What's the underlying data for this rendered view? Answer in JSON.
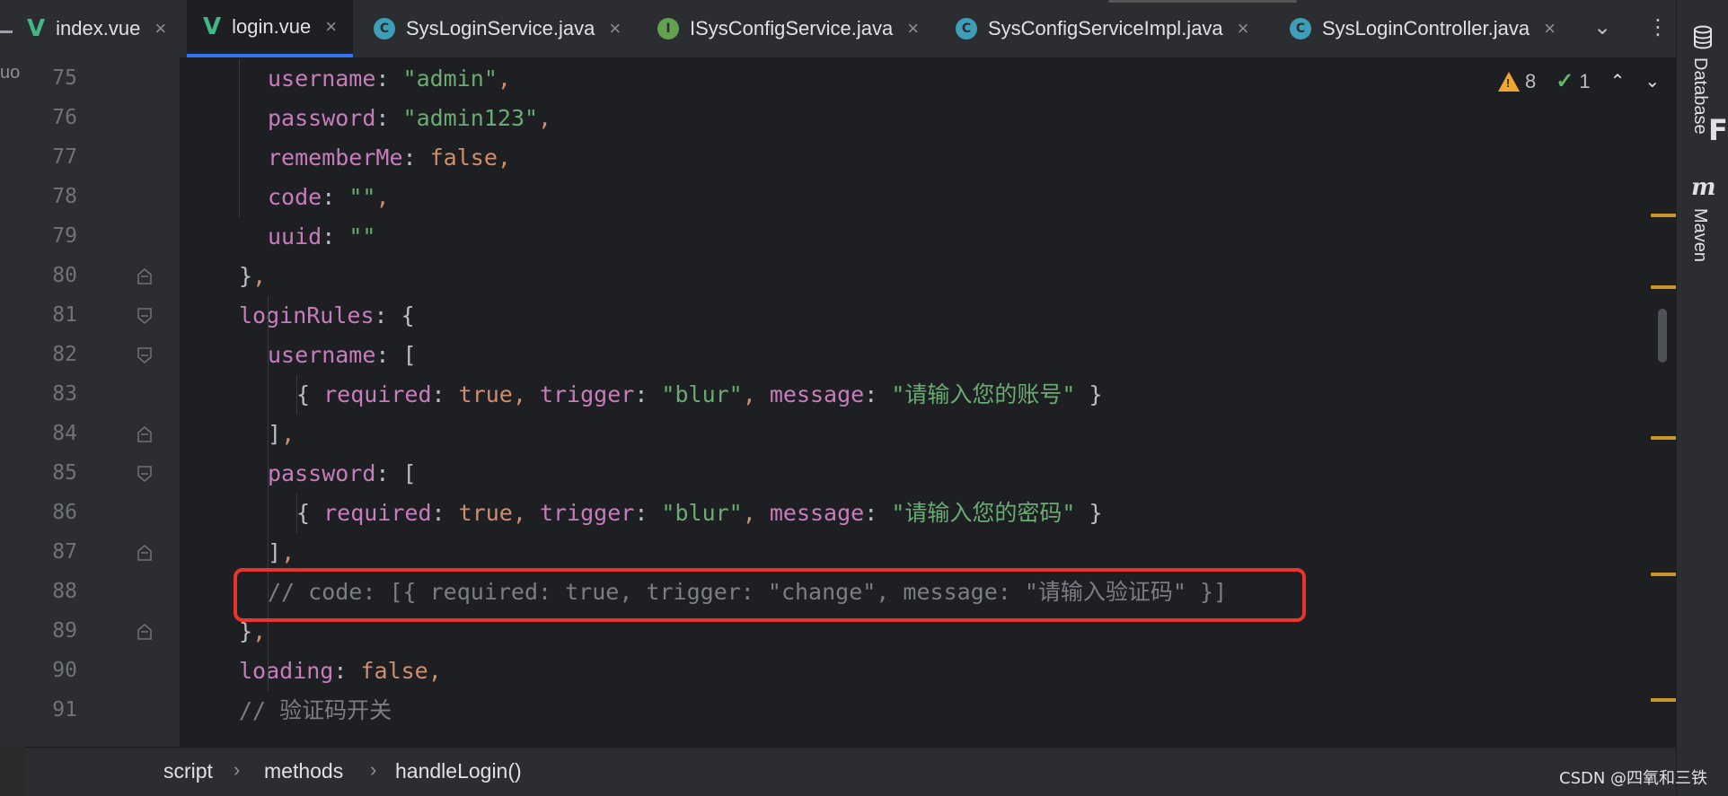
{
  "tabs": [
    {
      "icon": "vue-icon",
      "label": "index.vue",
      "active": false
    },
    {
      "icon": "vue-icon",
      "label": "login.vue",
      "active": true
    },
    {
      "icon": "class-icon",
      "label": "SysLoginService.java",
      "active": false
    },
    {
      "icon": "interface-icon",
      "label": "ISysConfigService.java",
      "active": false
    },
    {
      "icon": "class-icon",
      "label": "SysConfigServiceImpl.java",
      "active": false
    },
    {
      "icon": "class-icon",
      "label": "SysLoginController.java",
      "active": false
    }
  ],
  "tab_glyphs": {
    "close": "×",
    "vue": "V",
    "class": "C",
    "interface": "I",
    "dropdown": "⌄",
    "more": "⋮"
  },
  "left_edge_text": "uo",
  "right_tools": {
    "database": "Database",
    "maven": "Maven",
    "maven_icon": "m",
    "edge_glyph": "F"
  },
  "inspections": {
    "warnings": "8",
    "weak_warnings": "1",
    "warn_mark": "!",
    "check_mark": "✓",
    "up": "⌃",
    "down": "⌄"
  },
  "lines": [
    {
      "n": "75",
      "segs": [
        [
          "k",
          "username"
        ],
        [
          "p",
          ": "
        ],
        [
          "s",
          "\"admin\""
        ],
        [
          "b",
          ","
        ]
      ]
    },
    {
      "n": "76",
      "segs": [
        [
          "k",
          "password"
        ],
        [
          "p",
          ": "
        ],
        [
          "s",
          "\"admin123\""
        ],
        [
          "b",
          ","
        ]
      ]
    },
    {
      "n": "77",
      "segs": [
        [
          "k",
          "rememberMe"
        ],
        [
          "p",
          ": "
        ],
        [
          "b",
          "false,"
        ]
      ]
    },
    {
      "n": "78",
      "segs": [
        [
          "k",
          "code"
        ],
        [
          "p",
          ": "
        ],
        [
          "s",
          "\"\""
        ],
        [
          "b",
          ","
        ]
      ]
    },
    {
      "n": "79",
      "segs": [
        [
          "k",
          "uuid"
        ],
        [
          "p",
          ": "
        ],
        [
          "s",
          "\"\""
        ]
      ]
    },
    {
      "n": "80",
      "segs": [
        [
          "p",
          "}"
        ],
        [
          "b",
          ","
        ]
      ]
    },
    {
      "n": "81",
      "segs": [
        [
          "k",
          "loginRules"
        ],
        [
          "p",
          ": {"
        ]
      ]
    },
    {
      "n": "82",
      "segs": [
        [
          "k",
          "username"
        ],
        [
          "p",
          ": ["
        ]
      ]
    },
    {
      "n": "83",
      "segs": [
        [
          "p",
          "{ "
        ],
        [
          "k",
          "required"
        ],
        [
          "p",
          ": "
        ],
        [
          "b",
          "true, "
        ],
        [
          "k",
          "trigger"
        ],
        [
          "p",
          ": "
        ],
        [
          "s",
          "\"blur\""
        ],
        [
          "b",
          ", "
        ],
        [
          "k",
          "message"
        ],
        [
          "p",
          ": "
        ],
        [
          "s",
          "\"请输入您的账号\""
        ],
        [
          "p",
          " }"
        ]
      ]
    },
    {
      "n": "84",
      "segs": [
        [
          "p",
          "]"
        ],
        [
          "b",
          ","
        ]
      ]
    },
    {
      "n": "85",
      "segs": [
        [
          "k",
          "password"
        ],
        [
          "p",
          ": ["
        ]
      ]
    },
    {
      "n": "86",
      "segs": [
        [
          "p",
          "{ "
        ],
        [
          "k",
          "required"
        ],
        [
          "p",
          ": "
        ],
        [
          "b",
          "true, "
        ],
        [
          "k",
          "trigger"
        ],
        [
          "p",
          ": "
        ],
        [
          "s",
          "\"blur\""
        ],
        [
          "b",
          ", "
        ],
        [
          "k",
          "message"
        ],
        [
          "p",
          ": "
        ],
        [
          "s",
          "\"请输入您的密码\""
        ],
        [
          "p",
          " }"
        ]
      ]
    },
    {
      "n": "87",
      "segs": [
        [
          "p",
          "]"
        ],
        [
          "b",
          ","
        ]
      ]
    },
    {
      "n": "88",
      "segs": [
        [
          "cm",
          "// code: [{ required: true, trigger: \"change\", message: \"请输入验证码\" }]"
        ]
      ]
    },
    {
      "n": "89",
      "segs": [
        [
          "p",
          "}"
        ],
        [
          "b",
          ","
        ]
      ]
    },
    {
      "n": "90",
      "segs": [
        [
          "k",
          "loading"
        ],
        [
          "p",
          ": "
        ],
        [
          "b",
          "false,"
        ]
      ]
    },
    {
      "n": "91",
      "segs": [
        [
          "cm",
          "// 验证码开关"
        ]
      ]
    }
  ],
  "breadcrumb": [
    "script",
    "methods",
    "handleLogin()"
  ],
  "breadcrumb_sep": "›",
  "watermark": "CSDN @四氧和三铁"
}
